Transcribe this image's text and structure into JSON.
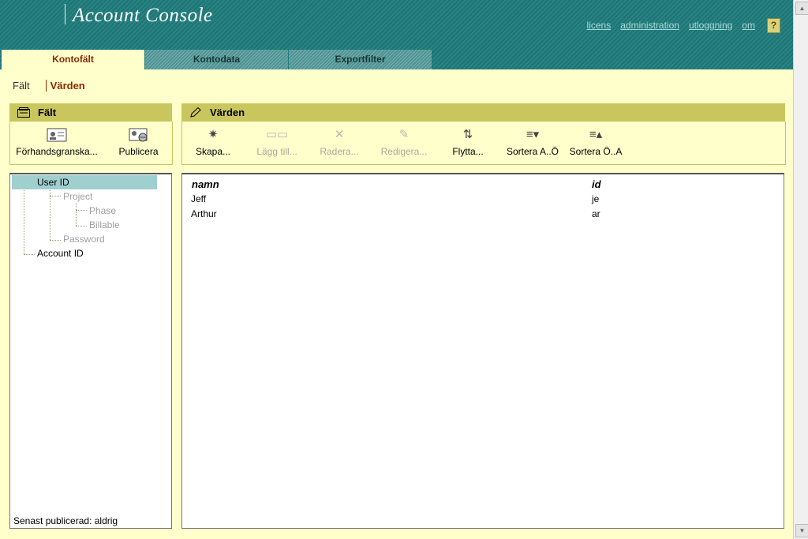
{
  "app": {
    "title": "Account Console"
  },
  "toplinks": [
    "licens",
    "administration",
    "utloggning",
    "om"
  ],
  "help": "?",
  "tabs": [
    {
      "label": "Kontofält",
      "active": true
    },
    {
      "label": "Kontodata",
      "active": false
    },
    {
      "label": "Exportfilter",
      "active": false
    }
  ],
  "subtabs": [
    {
      "label": "Fält",
      "active": false
    },
    {
      "label": "Värden",
      "active": true
    }
  ],
  "left_panel": {
    "title": "Fält",
    "buttons": [
      {
        "label": "Förhandsgranska...",
        "icon": "preview-icon"
      },
      {
        "label": "Publicera",
        "icon": "publish-icon"
      }
    ],
    "tree": [
      {
        "label": "User ID",
        "level": 0,
        "selected": true,
        "dim": false
      },
      {
        "label": "Project",
        "level": 1,
        "selected": false,
        "dim": true
      },
      {
        "label": "Phase",
        "level": 2,
        "selected": false,
        "dim": true
      },
      {
        "label": "Billable",
        "level": 2,
        "selected": false,
        "dim": true
      },
      {
        "label": "Password",
        "level": 1,
        "selected": false,
        "dim": true
      },
      {
        "label": "Account ID",
        "level": 0,
        "selected": false,
        "dim": false
      }
    ],
    "status": "Senast publicerad: aldrig"
  },
  "right_panel": {
    "title": "Värden",
    "buttons": [
      {
        "label": "Skapa...",
        "icon": "create-icon",
        "enabled": true
      },
      {
        "label": "Lägg till...",
        "icon": "add-icon",
        "enabled": false
      },
      {
        "label": "Radera...",
        "icon": "delete-icon",
        "enabled": false
      },
      {
        "label": "Redigera...",
        "icon": "edit-icon",
        "enabled": false
      },
      {
        "label": "Flytta...",
        "icon": "move-icon",
        "enabled": true
      },
      {
        "label": "Sortera A..Ö",
        "icon": "sort-asc-icon",
        "enabled": true
      },
      {
        "label": "Sortera Ö..A",
        "icon": "sort-desc-icon",
        "enabled": true
      }
    ],
    "table": {
      "columns": [
        "namn",
        "id"
      ],
      "rows": [
        [
          "Jeff",
          "je"
        ],
        [
          "Arthur",
          "ar"
        ]
      ]
    }
  },
  "colors": {
    "header": "#1f7b7b",
    "panel_head": "#c8c65c",
    "background": "#ffffcc",
    "active_text": "#8b2a00"
  }
}
